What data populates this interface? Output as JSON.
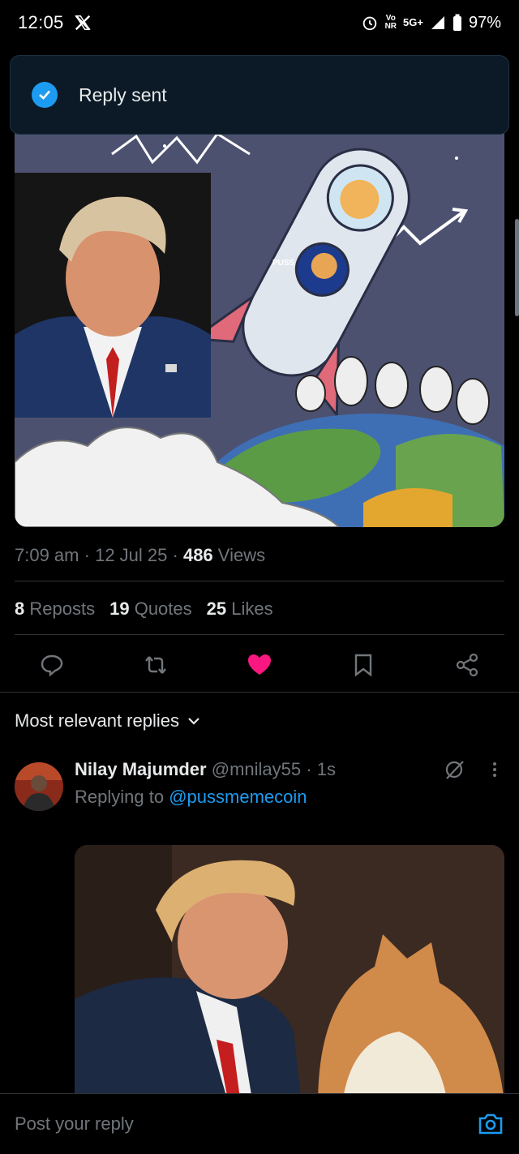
{
  "status_bar": {
    "time": "12:05",
    "battery": "97%",
    "network_top": "Vo",
    "network_bottom": "NR",
    "signal": "5G+"
  },
  "toast": {
    "message": "Reply sent",
    "icon": "check-circle-icon",
    "color": "#1d9bf0"
  },
  "post": {
    "image_badge": "PUSS",
    "time": "7:09 am",
    "date": "12 Jul 25",
    "views_count": "486",
    "views_label": "Views",
    "reposts_count": "8",
    "reposts_label": "Reposts",
    "quotes_count": "19",
    "quotes_label": "Quotes",
    "likes_count": "25",
    "likes_label": "Likes",
    "like_color": "#f91880"
  },
  "replies": {
    "sort_label": "Most relevant replies",
    "items": [
      {
        "name": "Nilay Majumder",
        "handle": "@mnilay55",
        "time": "1s",
        "replying_prefix": "Replying to",
        "replying_to": "@pussmemecoin"
      }
    ]
  },
  "composer": {
    "placeholder": "Post your reply"
  },
  "separator": "·"
}
